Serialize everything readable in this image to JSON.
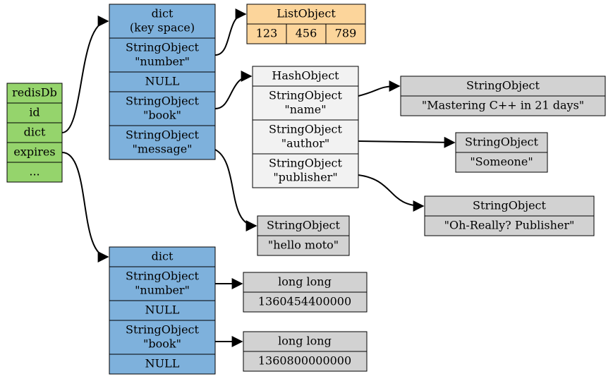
{
  "redisDb": {
    "title": "redisDb",
    "fields": [
      "id",
      "dict",
      "expires",
      "..."
    ]
  },
  "keyspace": {
    "title_l1": "dict",
    "title_l2": "(key space)",
    "rows": [
      {
        "l1": "StringObject",
        "l2": "\"number\""
      },
      {
        "l1": "NULL"
      },
      {
        "l1": "StringObject",
        "l2": "\"book\""
      },
      {
        "l1": "StringObject",
        "l2": "\"message\""
      }
    ]
  },
  "expires_dict": {
    "title": "dict",
    "rows": [
      {
        "l1": "StringObject",
        "l2": "\"number\""
      },
      {
        "l1": "NULL"
      },
      {
        "l1": "StringObject",
        "l2": "\"book\""
      },
      {
        "l1": "NULL"
      }
    ]
  },
  "listObject": {
    "title": "ListObject",
    "items": [
      "123",
      "456",
      "789"
    ]
  },
  "hashObject": {
    "title": "HashObject",
    "rows": [
      {
        "l1": "StringObject",
        "l2": "\"name\""
      },
      {
        "l1": "StringObject",
        "l2": "\"author\""
      },
      {
        "l1": "StringObject",
        "l2": "\"publisher\""
      }
    ]
  },
  "bookName": {
    "t": "StringObject",
    "v": "\"Mastering C++ in 21 days\""
  },
  "bookAuthor": {
    "t": "StringObject",
    "v": "\"Someone\""
  },
  "bookPub": {
    "t": "StringObject",
    "v": "\"Oh-Really? Publisher\""
  },
  "message": {
    "t": "StringObject",
    "v": "\"hello moto\""
  },
  "exp1": {
    "t": "long long",
    "v": "1360454400000"
  },
  "exp2": {
    "t": "long long",
    "v": "1360800000000"
  }
}
